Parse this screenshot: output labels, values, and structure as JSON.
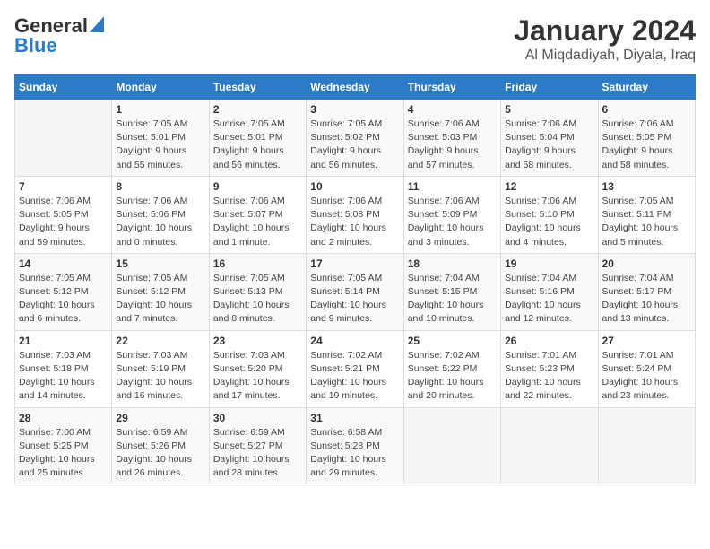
{
  "header": {
    "logo_line1": "General",
    "logo_line2": "Blue",
    "title": "January 2024",
    "subtitle": "Al Miqdadiyah, Diyala, Iraq"
  },
  "weekdays": [
    "Sunday",
    "Monday",
    "Tuesday",
    "Wednesday",
    "Thursday",
    "Friday",
    "Saturday"
  ],
  "weeks": [
    [
      {
        "day": "",
        "info": ""
      },
      {
        "day": "1",
        "info": "Sunrise: 7:05 AM\nSunset: 5:01 PM\nDaylight: 9 hours\nand 55 minutes."
      },
      {
        "day": "2",
        "info": "Sunrise: 7:05 AM\nSunset: 5:01 PM\nDaylight: 9 hours\nand 56 minutes."
      },
      {
        "day": "3",
        "info": "Sunrise: 7:05 AM\nSunset: 5:02 PM\nDaylight: 9 hours\nand 56 minutes."
      },
      {
        "day": "4",
        "info": "Sunrise: 7:06 AM\nSunset: 5:03 PM\nDaylight: 9 hours\nand 57 minutes."
      },
      {
        "day": "5",
        "info": "Sunrise: 7:06 AM\nSunset: 5:04 PM\nDaylight: 9 hours\nand 58 minutes."
      },
      {
        "day": "6",
        "info": "Sunrise: 7:06 AM\nSunset: 5:05 PM\nDaylight: 9 hours\nand 58 minutes."
      }
    ],
    [
      {
        "day": "7",
        "info": "Sunrise: 7:06 AM\nSunset: 5:05 PM\nDaylight: 9 hours\nand 59 minutes."
      },
      {
        "day": "8",
        "info": "Sunrise: 7:06 AM\nSunset: 5:06 PM\nDaylight: 10 hours\nand 0 minutes."
      },
      {
        "day": "9",
        "info": "Sunrise: 7:06 AM\nSunset: 5:07 PM\nDaylight: 10 hours\nand 1 minute."
      },
      {
        "day": "10",
        "info": "Sunrise: 7:06 AM\nSunset: 5:08 PM\nDaylight: 10 hours\nand 2 minutes."
      },
      {
        "day": "11",
        "info": "Sunrise: 7:06 AM\nSunset: 5:09 PM\nDaylight: 10 hours\nand 3 minutes."
      },
      {
        "day": "12",
        "info": "Sunrise: 7:06 AM\nSunset: 5:10 PM\nDaylight: 10 hours\nand 4 minutes."
      },
      {
        "day": "13",
        "info": "Sunrise: 7:05 AM\nSunset: 5:11 PM\nDaylight: 10 hours\nand 5 minutes."
      }
    ],
    [
      {
        "day": "14",
        "info": "Sunrise: 7:05 AM\nSunset: 5:12 PM\nDaylight: 10 hours\nand 6 minutes."
      },
      {
        "day": "15",
        "info": "Sunrise: 7:05 AM\nSunset: 5:12 PM\nDaylight: 10 hours\nand 7 minutes."
      },
      {
        "day": "16",
        "info": "Sunrise: 7:05 AM\nSunset: 5:13 PM\nDaylight: 10 hours\nand 8 minutes."
      },
      {
        "day": "17",
        "info": "Sunrise: 7:05 AM\nSunset: 5:14 PM\nDaylight: 10 hours\nand 9 minutes."
      },
      {
        "day": "18",
        "info": "Sunrise: 7:04 AM\nSunset: 5:15 PM\nDaylight: 10 hours\nand 10 minutes."
      },
      {
        "day": "19",
        "info": "Sunrise: 7:04 AM\nSunset: 5:16 PM\nDaylight: 10 hours\nand 12 minutes."
      },
      {
        "day": "20",
        "info": "Sunrise: 7:04 AM\nSunset: 5:17 PM\nDaylight: 10 hours\nand 13 minutes."
      }
    ],
    [
      {
        "day": "21",
        "info": "Sunrise: 7:03 AM\nSunset: 5:18 PM\nDaylight: 10 hours\nand 14 minutes."
      },
      {
        "day": "22",
        "info": "Sunrise: 7:03 AM\nSunset: 5:19 PM\nDaylight: 10 hours\nand 16 minutes."
      },
      {
        "day": "23",
        "info": "Sunrise: 7:03 AM\nSunset: 5:20 PM\nDaylight: 10 hours\nand 17 minutes."
      },
      {
        "day": "24",
        "info": "Sunrise: 7:02 AM\nSunset: 5:21 PM\nDaylight: 10 hours\nand 19 minutes."
      },
      {
        "day": "25",
        "info": "Sunrise: 7:02 AM\nSunset: 5:22 PM\nDaylight: 10 hours\nand 20 minutes."
      },
      {
        "day": "26",
        "info": "Sunrise: 7:01 AM\nSunset: 5:23 PM\nDaylight: 10 hours\nand 22 minutes."
      },
      {
        "day": "27",
        "info": "Sunrise: 7:01 AM\nSunset: 5:24 PM\nDaylight: 10 hours\nand 23 minutes."
      }
    ],
    [
      {
        "day": "28",
        "info": "Sunrise: 7:00 AM\nSunset: 5:25 PM\nDaylight: 10 hours\nand 25 minutes."
      },
      {
        "day": "29",
        "info": "Sunrise: 6:59 AM\nSunset: 5:26 PM\nDaylight: 10 hours\nand 26 minutes."
      },
      {
        "day": "30",
        "info": "Sunrise: 6:59 AM\nSunset: 5:27 PM\nDaylight: 10 hours\nand 28 minutes."
      },
      {
        "day": "31",
        "info": "Sunrise: 6:58 AM\nSunset: 5:28 PM\nDaylight: 10 hours\nand 29 minutes."
      },
      {
        "day": "",
        "info": ""
      },
      {
        "day": "",
        "info": ""
      },
      {
        "day": "",
        "info": ""
      }
    ]
  ]
}
